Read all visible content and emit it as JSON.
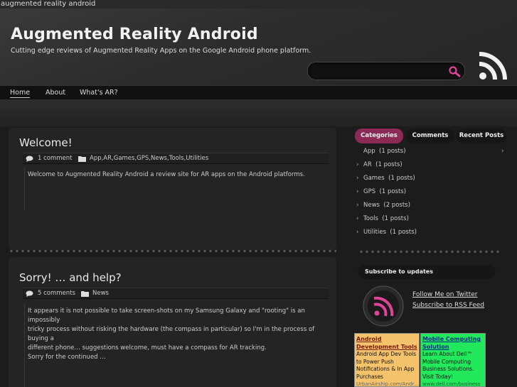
{
  "browser": {
    "title": "augmented reality android"
  },
  "header": {
    "site_title": "Augmented Reality Android",
    "site_description": "Cutting edge reviews of Augmented Reality Apps on the Google Android phone platform.",
    "search_placeholder": ""
  },
  "nav": {
    "items": [
      "Home",
      "About",
      "What's AR?"
    ],
    "active": "Home"
  },
  "posts": [
    {
      "title": "Welcome!",
      "comments": "1 comment",
      "categories": "App,AR,Games,GPS,News,Tools,Utilities",
      "body": [
        "Welcome to Augmented Reality Android a review site for AR apps on the Android platforms."
      ]
    },
    {
      "title": "Sorry! … and help?",
      "comments": "5 comments",
      "categories": "News",
      "body": [
        "It appears it is not possible to take screen-shots on my Samsung Galaxy and \"rooting\" is an impossibly",
        "tricky process  without risking the hardware (the compass in particular) so I'm in the process of buying a",
        "different phone… suggestions welcome, must have a compass for AR tracking.",
        "Sorry for the continued …"
      ]
    }
  ],
  "sidebar": {
    "tabs": [
      "Categories",
      "Comments",
      "Recent Posts"
    ],
    "active_tab": "Categories",
    "categories": [
      {
        "name": "App",
        "count": "(1 posts)"
      },
      {
        "name": "AR",
        "count": "(1 posts)"
      },
      {
        "name": "Games",
        "count": "(1 posts)"
      },
      {
        "name": "GPS",
        "count": "(1 posts)"
      },
      {
        "name": "News",
        "count": "(2 posts)"
      },
      {
        "name": "Tools",
        "count": "(1 posts)"
      },
      {
        "name": "Utilities",
        "count": "(1 posts)"
      }
    ],
    "arrow_glyph": "›",
    "subscribe_title": "Subscribe to updates",
    "follow_twitter": "Follow Me on Twitter",
    "subscribe_rss": "Subscribe to RSS Feed",
    "ads": [
      {
        "title": "Android Development Tools",
        "body": "Android App Dev Tools to Power Push Notifications & In App Purchases",
        "url": "UrbanAirship.com/Andr…",
        "bg_color": "#f5c36b"
      },
      {
        "title": "Mobile Computing Solution",
        "body": "Learn About Dell™ Mobile Computing Business Solutions. Visit Today!",
        "url": "www.dell.com/business",
        "bg_color": "#22e85c"
      }
    ]
  },
  "colors": {
    "accent": "#8a2a55",
    "search_icon": "#e0449a"
  }
}
